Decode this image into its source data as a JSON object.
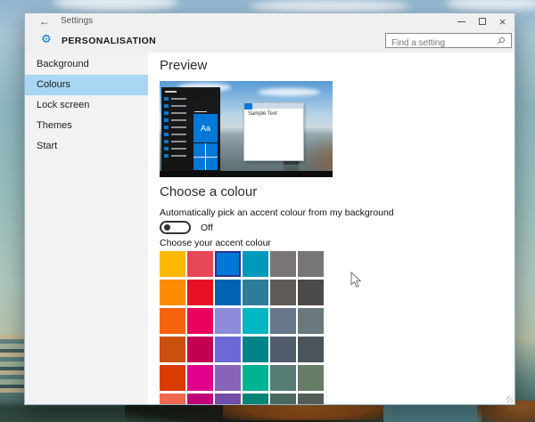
{
  "colors": {
    "accent": "#0078D7",
    "sidebar_highlight": "#A9D6F2",
    "selected_swatch_border": "#2D3192",
    "chrome_bg": "#F0F0F0",
    "sidebar_bg": "#F2F2F2"
  },
  "titlebar": {
    "back_icon": "←",
    "app_title": "Settings",
    "close_icon": "×"
  },
  "header": {
    "page_title": "PERSONALISATION",
    "gear_icon": "⚙",
    "search_placeholder": "Find a setting"
  },
  "sidebar": {
    "items": [
      {
        "label": "Background",
        "selected": false
      },
      {
        "label": "Colours",
        "selected": true
      },
      {
        "label": "Lock screen",
        "selected": false
      },
      {
        "label": "Themes",
        "selected": false
      },
      {
        "label": "Start",
        "selected": false
      }
    ]
  },
  "content": {
    "preview_heading": "Preview",
    "preview": {
      "start_tile_label": "Aa",
      "sample_window_title": "Sample Text"
    },
    "choose_heading": "Choose a colour",
    "auto_accent_label": "Automatically pick an accent colour from my background",
    "toggle_label": "Off",
    "accent_section_label": "Choose your accent colour",
    "accent_swatches": [
      "#FFB900",
      "#E74856",
      "#0078D7",
      "#0099BC",
      "#7A7574",
      "#767676",
      "#FF8C00",
      "#E81123",
      "#0063B1",
      "#2D7D9A",
      "#5D5A58",
      "#4C4A48",
      "#F7630C",
      "#EA005E",
      "#8E8CD8",
      "#00B7C3",
      "#68768A",
      "#69797E",
      "#CA5010",
      "#C30052",
      "#6B69D6",
      "#038387",
      "#515C6B",
      "#4A5459",
      "#DA3B01",
      "#E3008C",
      "#8764B8",
      "#00B294",
      "#567C73",
      "#647C64",
      "#EF6950",
      "#BF0077",
      "#744DA9",
      "#018574",
      "#486860",
      "#525E54"
    ],
    "selected_swatch_index": 2
  }
}
